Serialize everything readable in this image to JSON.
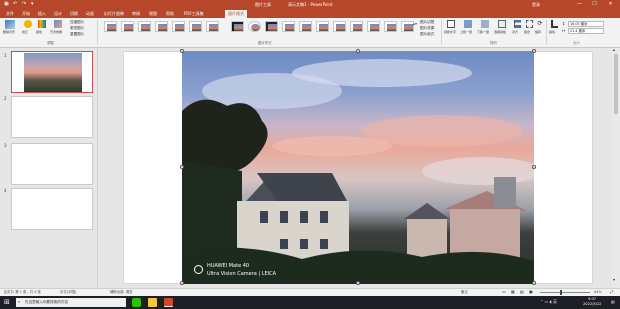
{
  "titlebar": {
    "context": "图片工具",
    "title": "演示文稿1 - PowerPoint",
    "user": "登录",
    "minimize": "—",
    "maximize": "☐",
    "close": "✕"
  },
  "tabs": [
    {
      "label": "文件"
    },
    {
      "label": "开始"
    },
    {
      "label": "插入"
    },
    {
      "label": "设计"
    },
    {
      "label": "切换"
    },
    {
      "label": "动画"
    },
    {
      "label": "幻灯片放映"
    },
    {
      "label": "审阅"
    },
    {
      "label": "视图"
    },
    {
      "label": "帮助"
    },
    {
      "label": "PDF工具集"
    },
    {
      "label": "图片格式"
    }
  ],
  "tell_me": "操作说明搜索",
  "share": "共享",
  "ribbon": {
    "remove_bg": "删除背景",
    "corrections": "校正",
    "color": "颜色",
    "artistic": "艺术效果",
    "compress": "压缩图片",
    "change": "更改图片",
    "reset": "重置图片",
    "adjust_label": "调整",
    "styles_label": "图片样式",
    "border": "图片边框",
    "effects": "图片效果",
    "layout": "图片版式",
    "alt_text": "替换文字",
    "bring_forward": "上移一层",
    "send_backward": "下移一层",
    "selection_pane": "选择窗格",
    "align": "对齐",
    "group": "组合",
    "rotate": "旋转",
    "arrange_label": "排列",
    "crop": "裁剪",
    "height": "16.05 厘米",
    "width": "21.4 厘米",
    "size_label": "大小"
  },
  "slides": [
    {
      "num": "1"
    },
    {
      "num": "2"
    },
    {
      "num": "3"
    },
    {
      "num": "4"
    }
  ],
  "photo": {
    "watermark_brand": "HUAWEI Mate 40",
    "watermark_sub": "Ultra Vision Camera | LEICA"
  },
  "statusbar": {
    "slide_info": "幻灯片 第 1 张，共 4 张",
    "lang": "中文(中国)",
    "access": "辅助功能: 调查",
    "notes": "备注",
    "zoom": "44%"
  },
  "taskbar": {
    "search": "在这里输入你要搜索的内容",
    "time": "9:07",
    "date": "2022/5/22"
  },
  "colors": {
    "accent": "#b7472a",
    "taskbar": "#1c1f24"
  }
}
